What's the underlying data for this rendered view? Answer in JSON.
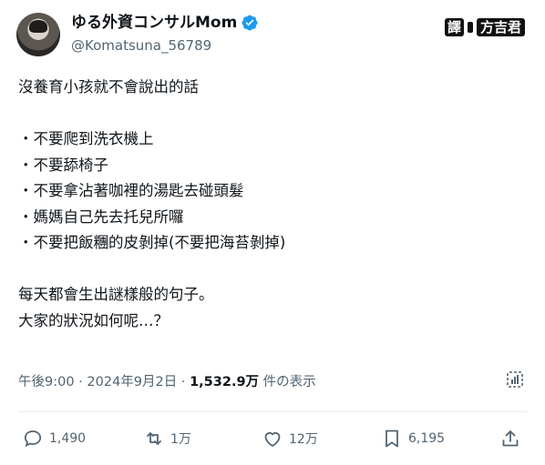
{
  "author": {
    "display_name": "ゆる外資コンサルMom",
    "handle": "@Komatsuna_56789",
    "verified": true
  },
  "watermark": {
    "label": "譯",
    "name": "方吉君"
  },
  "tweet": {
    "lines": [
      "沒養育小孩就不會說出的話",
      "",
      "・不要爬到洗衣機上",
      "・不要舔椅子",
      "・不要拿沾著咖裡的湯匙去碰頭髮",
      "・媽媽自己先去托兒所囉",
      "・不要把飯糰的皮剝掉(不要把海苔剝掉)",
      "",
      "每天都會生出謎樣般的句子。",
      "大家的狀況如何呢…？"
    ]
  },
  "meta": {
    "time": "午後9:00",
    "separator": " · ",
    "date": "2024年9月2日",
    "views_count": "1,532.9万",
    "views_label": " 件の表示"
  },
  "actions": {
    "reply_count": "1,490",
    "retweet_count": "1万",
    "like_count": "12万",
    "bookmark_count": "6,195"
  },
  "icons": {
    "verified": "verified-badge-icon",
    "analytics": "analytics-icon",
    "reply": "reply-icon",
    "retweet": "retweet-icon",
    "like": "heart-icon",
    "bookmark": "bookmark-icon",
    "share": "share-icon"
  },
  "colors": {
    "verified": "#1d9bf0",
    "text": "#0f1419",
    "muted": "#536471"
  }
}
